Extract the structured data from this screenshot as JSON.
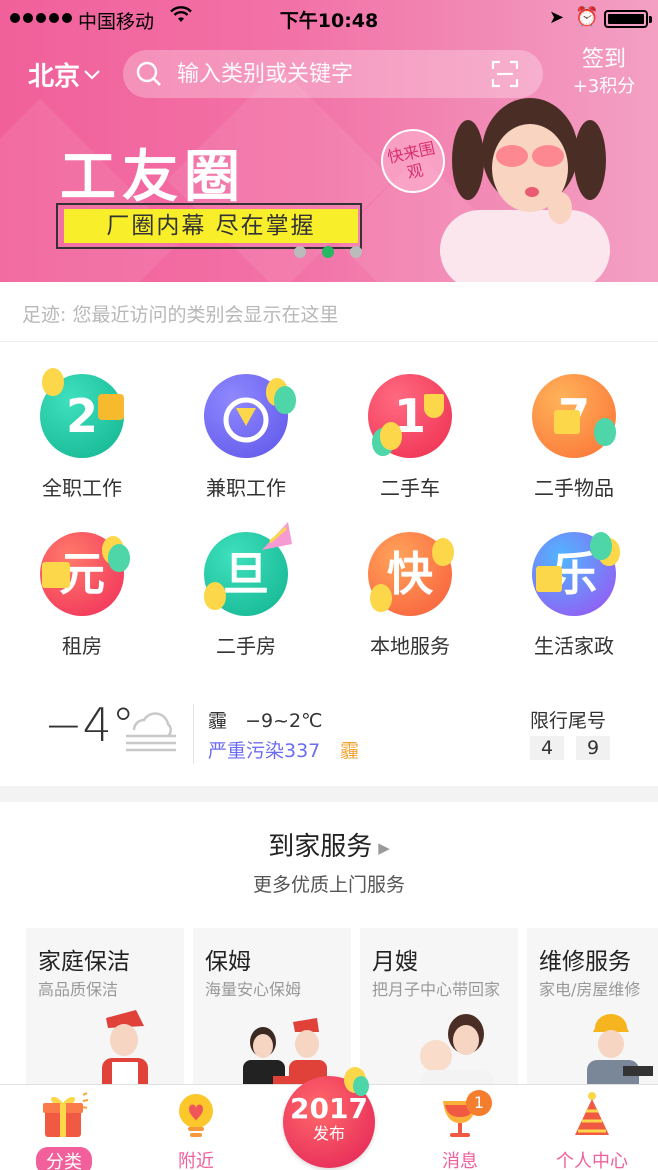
{
  "status_bar": {
    "carrier": "中国移动",
    "time": "下午10:48"
  },
  "header": {
    "city": "北京",
    "search_placeholder": "输入类别或关键字",
    "checkin_label": "签到",
    "checkin_points": "+3积分"
  },
  "banner": {
    "title": "工友圈",
    "subtitle": "厂圈内幕  尽在掌握",
    "badge": "快来围观",
    "page_count": 3,
    "active_page": 2
  },
  "footprint": {
    "text": "足迹: 您最近访问的类别会显示在这里"
  },
  "categories": [
    {
      "label": "全职工作",
      "glyph": "2",
      "color": "#17c2a0",
      "icon": "gift-icon"
    },
    {
      "label": "兼职工作",
      "glyph": "",
      "color": "#7a6ff0",
      "icon": "pizza-clock-icon"
    },
    {
      "label": "二手车",
      "glyph": "1",
      "color": "#f23c5e",
      "icon": "drink-icon"
    },
    {
      "label": "二手物品",
      "glyph": "7",
      "color": "#fb8b3a",
      "icon": "gift-icon"
    },
    {
      "label": "租房",
      "glyph": "元",
      "color": "#f34b5d",
      "icon": "gift-icon"
    },
    {
      "label": "二手房",
      "glyph": "旦",
      "color": "#16bf98",
      "icon": "party-hat-icon"
    },
    {
      "label": "本地服务",
      "glyph": "快",
      "color": "#fb7d3b",
      "icon": "balloon-icon"
    },
    {
      "label": "生活家政",
      "glyph": "乐",
      "color": "#8e6cf2",
      "icon": "balloon-icon"
    }
  ],
  "weather": {
    "temperature": "−4°",
    "condition": "霾",
    "range": "−9~2℃",
    "pollution": "严重污染337",
    "pollution_tag": "霾",
    "restriction_label": "限行尾号",
    "plates": [
      "4",
      "9"
    ]
  },
  "home_service": {
    "title": "到家服务",
    "subtitle": "更多优质上门服务",
    "cards": [
      {
        "title": "家庭保洁",
        "desc": "高品质保洁"
      },
      {
        "title": "保姆",
        "desc": "海量安心保姆"
      },
      {
        "title": "月嫂",
        "desc": "把月子中心带回家"
      },
      {
        "title": "维修服务",
        "desc": "家电/房屋维修"
      }
    ]
  },
  "tabbar": {
    "items": [
      {
        "label": "分类"
      },
      {
        "label": "附近"
      },
      {
        "label": "消息"
      },
      {
        "label": "个人中心"
      }
    ],
    "publish_year": "2017",
    "publish_label": "发布",
    "message_badge": "1"
  },
  "colors": {
    "brand_pink": "#f1609a",
    "banner_yellow": "#f8ef2a",
    "pollution_text": "#6d6df2"
  }
}
